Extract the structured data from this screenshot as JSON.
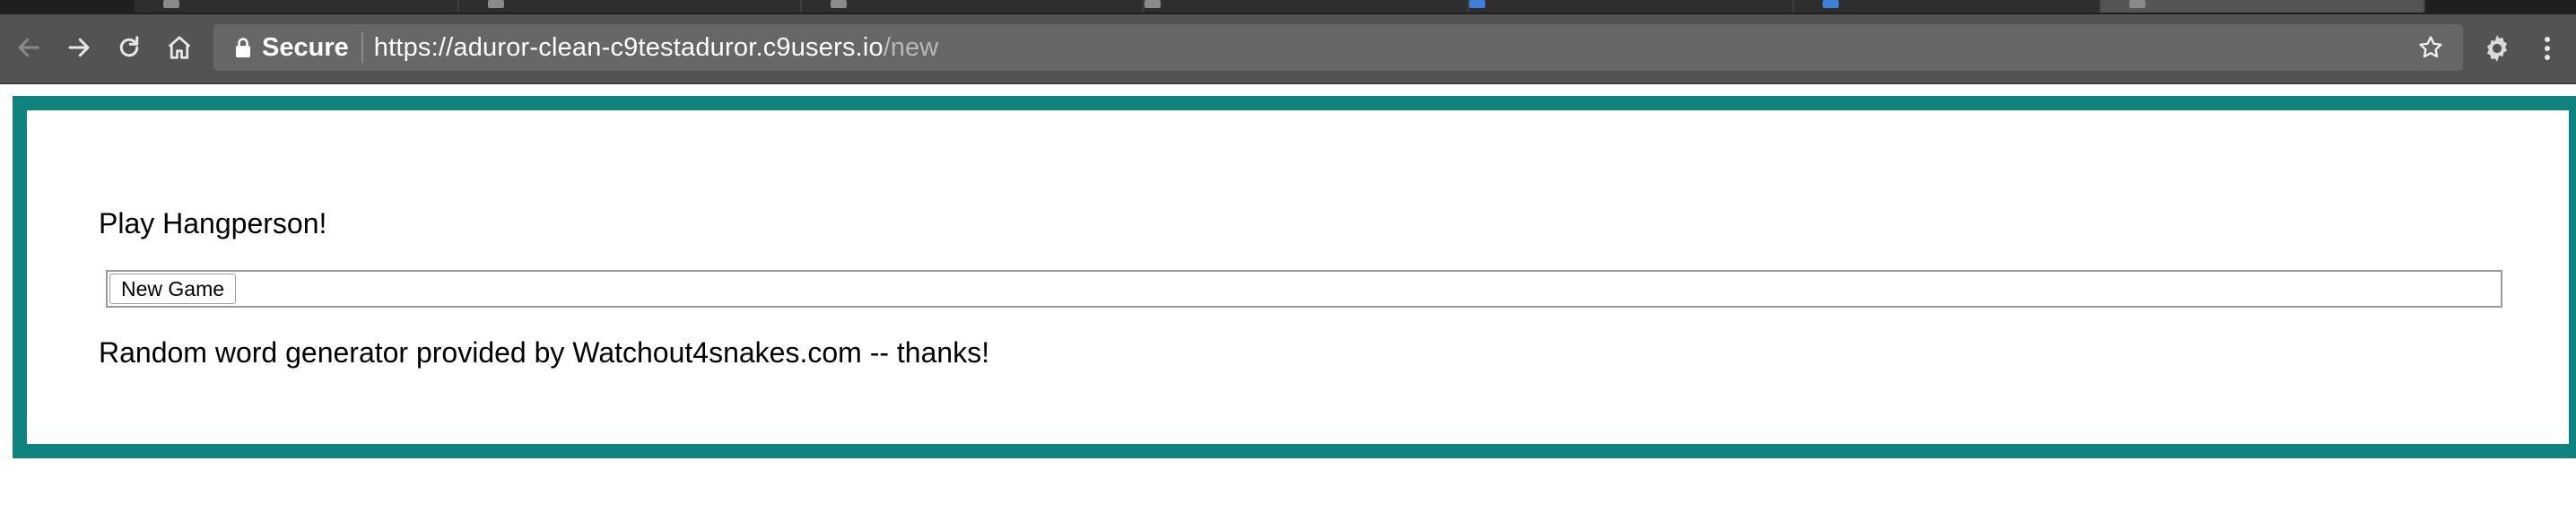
{
  "browser": {
    "tabs": [
      {
        "favicon": "github-icon"
      },
      {
        "favicon": "github-icon"
      },
      {
        "favicon": "github-icon"
      },
      {
        "favicon": "document-icon"
      },
      {
        "favicon": "blue-page-icon"
      },
      {
        "favicon": "blue-page-icon"
      },
      {
        "favicon": "page-icon"
      }
    ],
    "secure_label": "Secure",
    "url_host": "https://aduror-clean-c9testaduror.c9users.io",
    "url_path": "/new",
    "icons": {
      "back": "back-arrow-icon",
      "forward": "forward-arrow-icon",
      "reload": "reload-icon",
      "home": "home-icon",
      "lock": "lock-icon",
      "bookmark": "star-icon",
      "extension": "gear-icon",
      "menu": "kebab-menu-icon"
    }
  },
  "page": {
    "title": "Play Hangperson!",
    "new_game_label": "New Game",
    "credit_text": "Random word generator provided by Watchout4snakes.com -- thanks!",
    "frame_color": "#0e837f"
  }
}
